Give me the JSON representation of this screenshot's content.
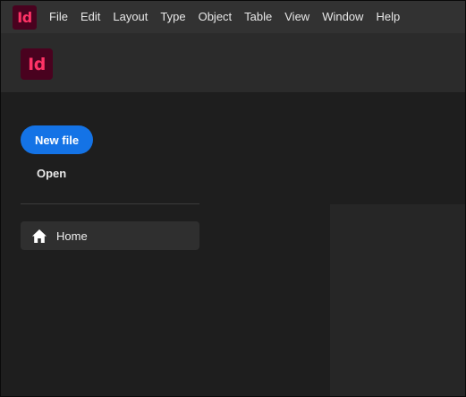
{
  "app": {
    "logo_text": "Id",
    "brand_color": "#49021f",
    "logo_letter_color": "#ff3366"
  },
  "menubar": {
    "items": [
      "File",
      "Edit",
      "Layout",
      "Type",
      "Object",
      "Table",
      "View",
      "Window",
      "Help"
    ]
  },
  "header": {
    "logo_text": "Id"
  },
  "sidebar": {
    "new_file_label": "New file",
    "open_label": "Open",
    "nav": [
      {
        "label": "Home",
        "icon": "home-icon",
        "selected": true
      }
    ]
  },
  "colors": {
    "accent": "#1473e6",
    "background": "#1e1e1e",
    "menubar": "#323232",
    "header": "#2b2b2b"
  }
}
